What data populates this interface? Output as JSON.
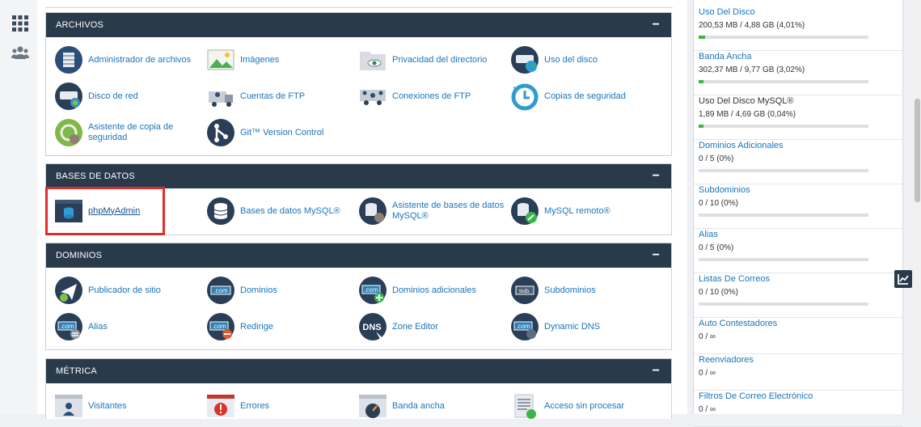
{
  "leftbar": {
    "icons": [
      "grid-icon",
      "users-icon"
    ]
  },
  "panels": {
    "archivos": {
      "title": "ARCHIVOS",
      "collapse": "−",
      "items": [
        {
          "label": "Administrador de archivos",
          "icon": "file-manager-icon"
        },
        {
          "label": "Imágenes",
          "icon": "images-icon"
        },
        {
          "label": "Privacidad del directorio",
          "icon": "directory-privacy-icon"
        },
        {
          "label": "Uso del disco",
          "icon": "disk-usage-icon"
        },
        {
          "label": "Disco de red",
          "icon": "network-disk-icon"
        },
        {
          "label": "Cuentas de FTP",
          "icon": "ftp-accounts-icon"
        },
        {
          "label": "Conexiones de FTP",
          "icon": "ftp-connections-icon"
        },
        {
          "label": "Copias de seguridad",
          "icon": "backup-icon"
        },
        {
          "label": "Asistente de copia de seguridad",
          "icon": "backup-wizard-icon"
        },
        {
          "label": "Git™ Version Control",
          "icon": "git-icon"
        }
      ]
    },
    "bases": {
      "title": "BASES DE DATOS",
      "collapse": "−",
      "items": [
        {
          "label": "phpMyAdmin",
          "icon": "phpmyadmin-icon"
        },
        {
          "label": "Bases de datos MySQL®",
          "icon": "mysql-databases-icon"
        },
        {
          "label": "Asistente de bases de datos MySQL®",
          "icon": "mysql-wizard-icon"
        },
        {
          "label": "MySQL remoto®",
          "icon": "remote-mysql-icon"
        }
      ]
    },
    "dominios": {
      "title": "DOMINIOS",
      "collapse": "−",
      "items": [
        {
          "label": "Publicador de sitio",
          "icon": "site-publisher-icon"
        },
        {
          "label": "Dominios",
          "icon": "domains-icon"
        },
        {
          "label": "Dominios adicionales",
          "icon": "addon-domains-icon"
        },
        {
          "label": "Subdominios",
          "icon": "subdomains-icon"
        },
        {
          "label": "Alias",
          "icon": "aliases-icon"
        },
        {
          "label": "Redirige",
          "icon": "redirects-icon"
        },
        {
          "label": "Zone Editor",
          "icon": "zone-editor-icon"
        },
        {
          "label": "Dynamic DNS",
          "icon": "dynamic-dns-icon"
        }
      ]
    },
    "metrica": {
      "title": "MÉTRICA",
      "collapse": "−",
      "items": [
        {
          "label": "Visitantes",
          "icon": "visitors-icon"
        },
        {
          "label": "Errores",
          "icon": "errors-icon"
        },
        {
          "label": "Banda ancha",
          "icon": "bandwidth-icon"
        },
        {
          "label": "Acceso sin procesar",
          "icon": "raw-access-icon"
        }
      ]
    }
  },
  "stats": [
    {
      "title": "Uso Del Disco",
      "value": "200,53 MB / 4,88 GB  (4,01%)",
      "fill": 0.0401,
      "link": true
    },
    {
      "title": "Banda Ancha",
      "value": "302,37 MB / 9,77 GB  (3,02%)",
      "fill": 0.0302,
      "link": true
    },
    {
      "title": "Uso Del Disco MySQL®",
      "value": "1,89 MB / 4,69 GB  (0,04%)",
      "fill": 0.0004,
      "link": false
    },
    {
      "title": "Dominios Adicionales",
      "value": "0 / 5  (0%)",
      "fill": 0,
      "link": true
    },
    {
      "title": "Subdominios",
      "value": "0 / 10  (0%)",
      "fill": 0,
      "link": true
    },
    {
      "title": "Alias",
      "value": "0 / 5  (0%)",
      "fill": 0,
      "link": true
    },
    {
      "title": "Listas De Correos",
      "value": "0 / 10  (0%)",
      "fill": 0,
      "link": true
    },
    {
      "title": "Auto Contestadores",
      "value": "0 / ∞",
      "link": true
    },
    {
      "title": "Reenviadores",
      "value": "0 / ∞",
      "link": true
    },
    {
      "title": "Filtros De Correo Electrónico",
      "value": "0 / ∞",
      "link": true
    }
  ],
  "colors": {
    "header": "#293a4a",
    "link": "#1b75bb",
    "highlight": "#e12b2b",
    "bar_fill": "#3bb54a"
  }
}
